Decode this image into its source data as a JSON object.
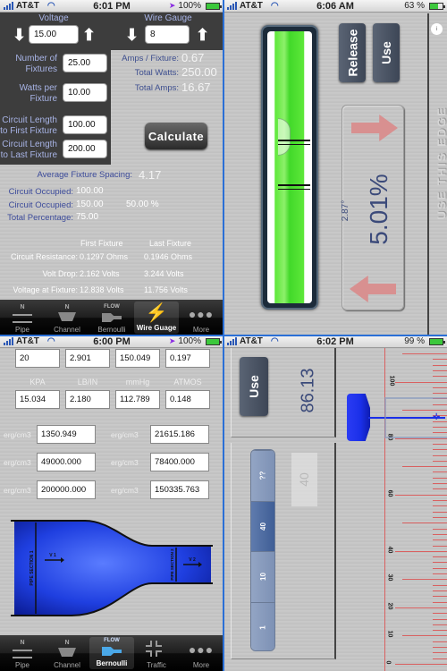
{
  "screens": {
    "wire_gauge": {
      "status": {
        "carrier": "AT&T",
        "time": "6:01 PM",
        "battery": "100%",
        "battery_level": 1.0
      },
      "voltage": {
        "label": "Voltage",
        "value": "15.00"
      },
      "wire_gauge": {
        "label": "Wire Gauge",
        "value": "8"
      },
      "inputs": [
        {
          "label_line1": "Number of",
          "label_line2": "Fixtures",
          "value": "25.00"
        },
        {
          "label_line1": "Watts per",
          "label_line2": "Fixture",
          "value": "10.00"
        },
        {
          "label_line1": "Circuit Length",
          "label_line2": "to First Fixture",
          "value": "100.00"
        },
        {
          "label_line1": "Circuit Length",
          "label_line2": "to Last Fixture",
          "value": "200.00"
        }
      ],
      "results": [
        {
          "label": "Amps / Fixture:",
          "value": "0.67"
        },
        {
          "label": "Total Watts:",
          "value": "250.00"
        },
        {
          "label": "Total Amps:",
          "value": "16.67"
        }
      ],
      "calculate_label": "Calculate",
      "avg_spacing": {
        "label": "Average Fixture Spacing:",
        "value": "4.17"
      },
      "circuit": [
        {
          "label": "Circuit Occupied:",
          "value": "100.00",
          "extra": ""
        },
        {
          "label": "Circuit Occupied:",
          "value": "150.00",
          "extra": "50.00 %"
        },
        {
          "label": "Total Percentage:",
          "value": "75.00",
          "extra": ""
        }
      ],
      "fixture_table": {
        "headers": [
          "First Fixture",
          "Last Fixture"
        ],
        "rows": [
          {
            "label": "Circuit Resistance:",
            "first": "0.1297 Ohms",
            "last": "0.1946 Ohms"
          },
          {
            "label": "Volt Drop:",
            "first": "2.162 Volts",
            "last": "3.244 Volts"
          },
          {
            "label": "Voltage at Fixture:",
            "first": "12.838 Volts",
            "last": "11.756 Volts"
          }
        ]
      },
      "tabs": [
        {
          "label": "Pipe",
          "icon": "pipe-icon"
        },
        {
          "label": "Channel",
          "icon": "channel-icon"
        },
        {
          "label": "Bernoulli",
          "icon": "flow-icon",
          "icon_text": "FLOW"
        },
        {
          "label": "Wire Guage",
          "icon": "lightning-icon",
          "active": true
        },
        {
          "label": "More",
          "icon": "more-icon"
        }
      ]
    },
    "level": {
      "status": {
        "carrier": "AT&T",
        "time": "6:06 AM",
        "battery": "63 %",
        "battery_level": 0.63
      },
      "release_label": "Release",
      "use_label": "Use",
      "degrees": "2.87°",
      "percent": "5.01%",
      "edge_text": "USE THIS EDGE",
      "info_label": "info"
    },
    "bernoulli": {
      "status": {
        "carrier": "AT&T",
        "time": "6:00 PM",
        "battery": "100%",
        "battery_level": 1.0
      },
      "top_row": [
        "20",
        "2.901",
        "150.049",
        "0.197"
      ],
      "unit_labels": [
        "KPA",
        "LB/IN",
        "mmHg",
        "ATMOS"
      ],
      "unit_values": [
        "15.034",
        "2.180",
        "112.789",
        "0.148"
      ],
      "energy_rows": [
        {
          "unit": "erg/cm3",
          "left": "1350.949",
          "right": "21615.186"
        },
        {
          "unit": "erg/cm3",
          "left": "49000.000",
          "right": "78400.000"
        },
        {
          "unit": "erg/cm3",
          "left": "200000.000",
          "right": "150335.763"
        }
      ],
      "diagram": {
        "section1": "PIPE SECTION 1",
        "section2": "PIPE SECTION 2",
        "v1": "V 1",
        "v2": "V 2"
      },
      "tabs": [
        {
          "label": "Pipe",
          "icon": "pipe-icon"
        },
        {
          "label": "Channel",
          "icon": "channel-icon"
        },
        {
          "label": "Bernoulli",
          "icon": "flow-icon",
          "icon_text": "FLOW",
          "active": true
        },
        {
          "label": "Traffic",
          "icon": "traffic-icon"
        },
        {
          "label": "More",
          "icon": "more-icon"
        }
      ]
    },
    "ruler": {
      "status": {
        "carrier": "AT&T",
        "time": "6:02 PM",
        "battery": "99 %",
        "battery_level": 0.99
      },
      "use_label": "Use",
      "reading": "86.13",
      "segments": [
        "??",
        "40",
        "10",
        "1"
      ],
      "selected_segment": "40",
      "ghost_value": "40",
      "ruler_labels": [
        "100",
        "80",
        "60",
        "40",
        "30",
        "20",
        "10",
        "0"
      ]
    }
  },
  "colors": {
    "label_blue": "#a8b4e6",
    "dark_label": "#3b4a9a",
    "vial_green": "#5ee83a",
    "arrow_red": "#d98a8a",
    "pipe_blue": "#1f3fe0",
    "ruler_red": "#d96060",
    "handle_blue": "#1a2fe8",
    "segment_blue": "#7d91b5"
  }
}
